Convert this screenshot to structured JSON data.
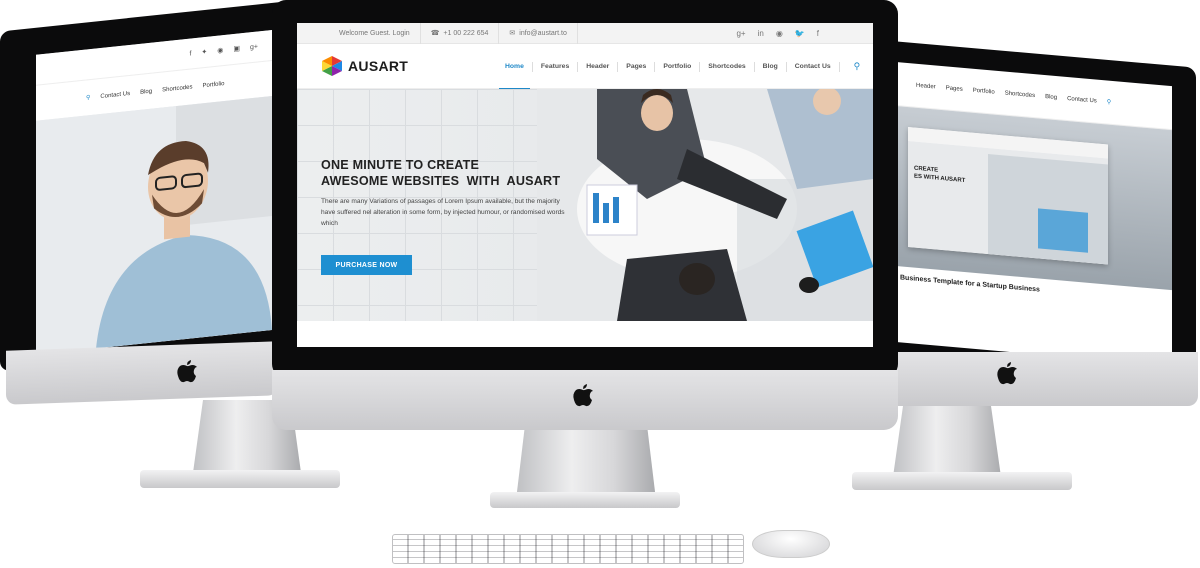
{
  "center": {
    "topbar": {
      "welcome": "Welcome Guest. Login",
      "phone_icon": "☎",
      "phone": "+1 00 222 654",
      "mail_icon": "✉",
      "email": "info@austart.to",
      "social": [
        "g+",
        "in",
        "◉",
        "🐦",
        "f"
      ]
    },
    "logo": "AUSART",
    "menu": [
      "Home",
      "Features",
      "Header",
      "Pages",
      "Portfolio",
      "Shortcodes",
      "Blog",
      "Contact Us"
    ],
    "hero": {
      "headline_1": "ONE MINUTE TO CREATE",
      "headline_2": "AWESOME WEBSITES  WITH  AUSART",
      "body": "There are many Variations of passages of Lorem Ipsum available, but the majority have suffered nel alteration in some form, by injected humour, or randomised words which",
      "cta": "PURCHASE NOW"
    }
  },
  "left": {
    "nav": [
      "Portfolio",
      "Shortcodes",
      "Blog",
      "Contact Us"
    ]
  },
  "right": {
    "nav": [
      "Header",
      "Pages",
      "Portfolio",
      "Shortcodes",
      "Blog",
      "Contact Us"
    ],
    "caption": "Business Template for a Startup Business"
  },
  "colors": {
    "accent": "#1e88c8",
    "logo_red": "#e53935",
    "logo_green": "#43a047",
    "logo_blue": "#1e88e5",
    "logo_purple": "#8e24aa"
  }
}
